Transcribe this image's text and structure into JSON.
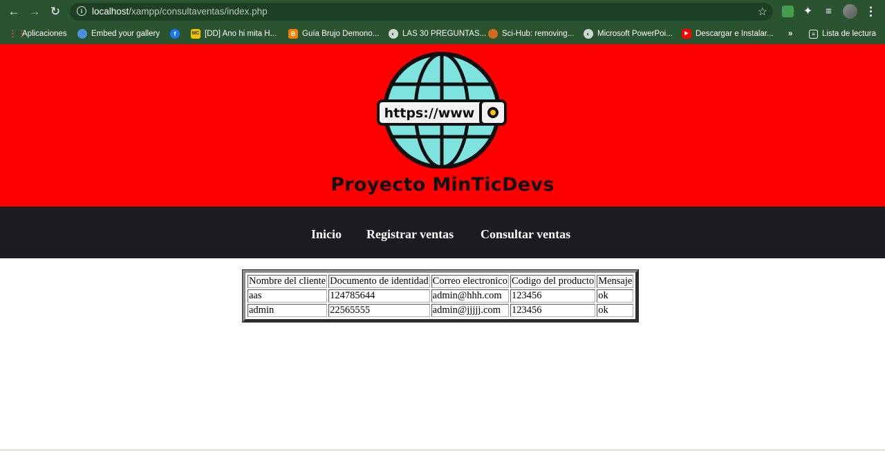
{
  "browser": {
    "url_host": "localhost",
    "url_path": "/xampp/consultaventas/index.php",
    "bookmarks": [
      {
        "label": "Aplicaciones",
        "icon": "apps-grid-icon",
        "color": "#e24a3b"
      },
      {
        "label": "Embed your gallery",
        "icon": "gallery-icon",
        "color": "#4a90d9"
      },
      {
        "label": "",
        "icon": "facebook-icon",
        "color": "#1877f2"
      },
      {
        "label": "[DD] Ano hi mita H...",
        "icon": "mc-icon",
        "color": "#f2c200"
      },
      {
        "label": "Guía Brujo Demono...",
        "icon": "blogger-icon",
        "color": "#f57d00"
      },
      {
        "label": "LAS 30 PREGUNTAS...",
        "icon": "globe-icon",
        "color": "#cfd8d1"
      },
      {
        "label": "Sci-Hub: removing...",
        "icon": "scihub-icon",
        "color": "#d2691e"
      },
      {
        "label": "Microsoft PowerPoi...",
        "icon": "globe-icon",
        "color": "#cfd8d1"
      },
      {
        "label": "Descargar e Instalar...",
        "icon": "youtube-icon",
        "color": "#ff0000"
      }
    ],
    "overflow": "»",
    "reading_list": "Lista de lectura"
  },
  "header": {
    "logo_text": "https://www",
    "title": "Proyecto MinTicDevs"
  },
  "nav": {
    "items": [
      "Inicio",
      "Registrar ventas",
      "Consultar ventas"
    ]
  },
  "table": {
    "columns": [
      "Nombre del cliente",
      "Documento de identidad",
      "Correo electronico",
      "Codigo del producto",
      "Mensaje"
    ],
    "rows": [
      [
        "aas",
        "124785644",
        "admin@hhh.com",
        "123456",
        "ok"
      ],
      [
        "admin",
        "22565555",
        "admin@jjjjj.com",
        "123456",
        "ok"
      ]
    ]
  },
  "colors": {
    "banner": "#ff0000",
    "navbar": "#1b1c21",
    "chrome": "#2a5330"
  }
}
